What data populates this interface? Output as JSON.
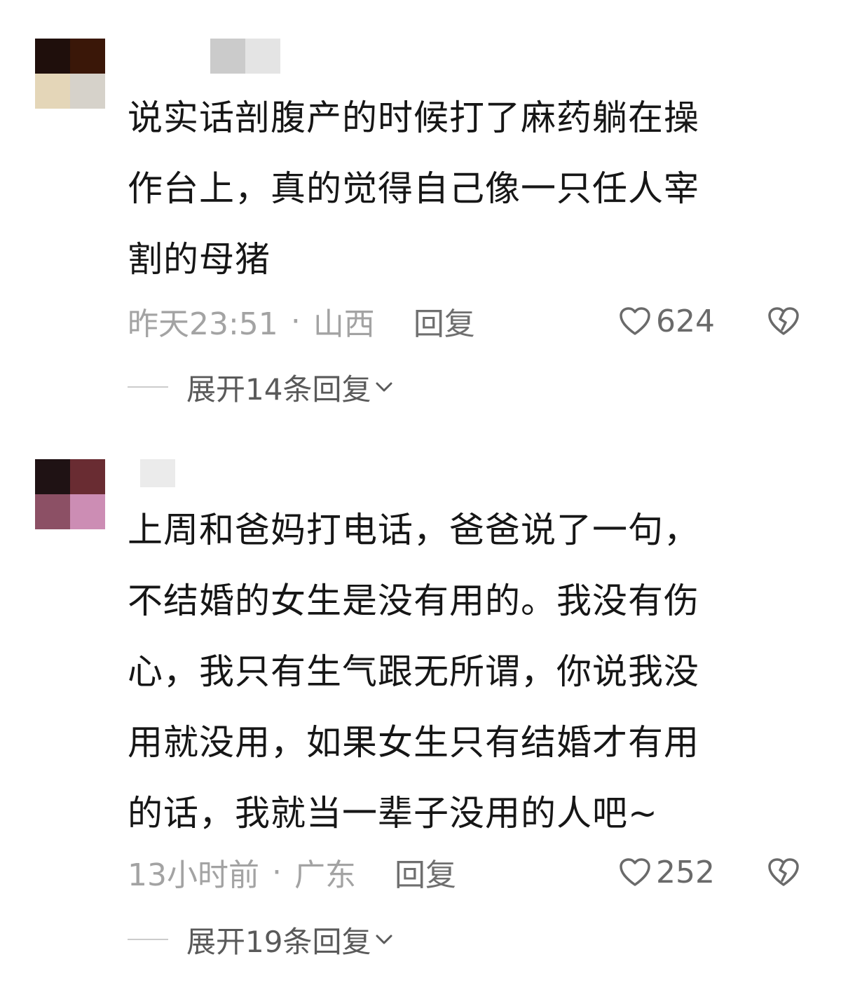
{
  "comments": [
    {
      "avatar_colors": [
        "#1f0f0c",
        "#3a1708",
        "#e4d6b8",
        "#d6d2ca"
      ],
      "username_colors": [
        "#cbcbcb",
        "#e4e4e4"
      ],
      "text": "说实话剖腹产的时候打了麻药躺在操\n作台上，真的觉得自己像一只任人宰\n割的母猪",
      "time": "昨天23:51",
      "dot": "·",
      "location": "山西",
      "reply_label": "回复",
      "likes": "624",
      "expand_label": "展开14条回复"
    },
    {
      "avatar_colors": [
        "#1f1214",
        "#692c32",
        "#8c5065",
        "#cc8db4"
      ],
      "username_colors": [
        "#ebebeb"
      ],
      "text": "上周和爸妈打电话，爸爸说了一句，\n不结婚的女生是没有用的。我没有伤\n心，我只有生气跟无所谓，你说我没\n用就没用，如果女生只有结婚才有用\n的话，我就当一辈子没用的人吧~",
      "time": "13小时前",
      "dot": "·",
      "location": "广东",
      "reply_label": "回复",
      "likes": "252",
      "expand_label": "展开19条回复"
    }
  ],
  "icons": {
    "like": "heart-outline-icon",
    "dislike": "broken-heart-icon",
    "expand": "chevron-down-icon"
  }
}
